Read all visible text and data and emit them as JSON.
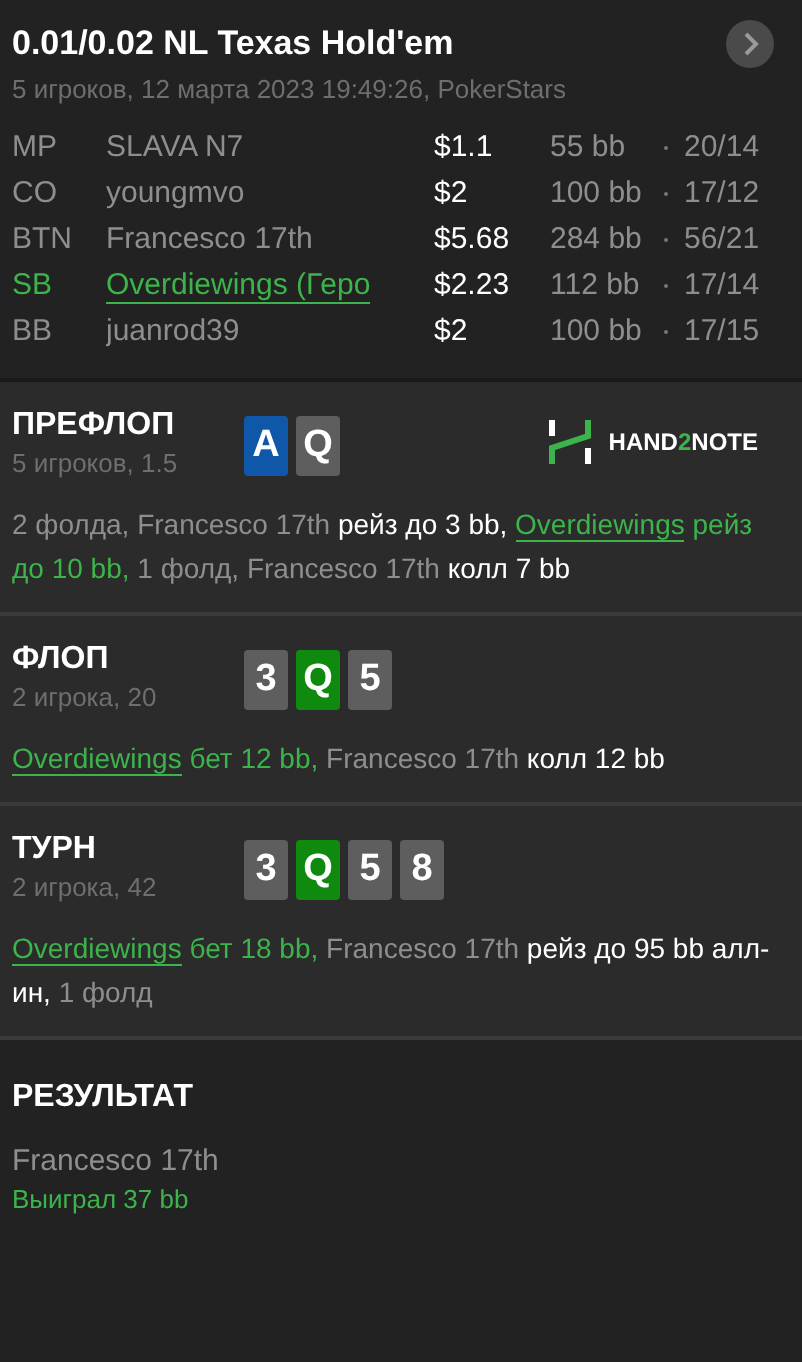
{
  "header": {
    "title": "0.01/0.02 NL Texas Hold'em",
    "subtitle": "5 игроков, 12 марта 2023 19:49:26, PokerStars"
  },
  "players": [
    {
      "position": "MP",
      "name": "SLAVA N7",
      "stack": "$1.1",
      "bb": "55 bb",
      "stats": "20/14",
      "hero": false
    },
    {
      "position": "CO",
      "name": "youngmvo",
      "stack": "$2",
      "bb": "100 bb",
      "stats": "17/12",
      "hero": false
    },
    {
      "position": "BTN",
      "name": "Francesco 17th",
      "stack": "$5.68",
      "bb": "284 bb",
      "stats": "56/21",
      "hero": false
    },
    {
      "position": "SB",
      "name": "Overdiewings (Геро",
      "stack": "$2.23",
      "bb": "112 bb",
      "stats": "17/14",
      "hero": true
    },
    {
      "position": "BB",
      "name": "juanrod39",
      "stack": "$2",
      "bb": "100 bb",
      "stats": "17/15",
      "hero": false
    }
  ],
  "streets": [
    {
      "title": "ПРЕФЛОП",
      "subtitle": "5 игроков, 1.5",
      "logo": [
        "HAND",
        "2",
        "NOTE"
      ],
      "cards": [
        {
          "rank": "A",
          "color": "#0f57a8"
        },
        {
          "rank": "Q",
          "color": "#5e5e5e"
        }
      ],
      "actions": [
        {
          "kind": "muted",
          "text": "2 фолда, Francesco 17th"
        },
        {
          "kind": "white",
          "text": "рейз до 3 bb,"
        },
        {
          "kind": "hero-name",
          "text": "Overdiewings"
        },
        {
          "kind": "hero",
          "text": "рейз до 10 bb,"
        },
        {
          "kind": "muted",
          "text": "1 фолд, Francesco 17th"
        },
        {
          "kind": "white",
          "text": "колл 7 bb"
        }
      ]
    },
    {
      "title": "ФЛОП",
      "subtitle": "2 игрока, 20",
      "cards": [
        {
          "rank": "3",
          "color": "#5e5e5e"
        },
        {
          "rank": "Q",
          "color": "#0f8a0f"
        },
        {
          "rank": "5",
          "color": "#5e5e5e"
        }
      ],
      "actions": [
        {
          "kind": "hero-name",
          "text": "Overdiewings"
        },
        {
          "kind": "hero",
          "text": "бет 12 bb,"
        },
        {
          "kind": "muted",
          "text": "Francesco 17th"
        },
        {
          "kind": "white",
          "text": "колл 12 bb"
        }
      ]
    },
    {
      "title": "ТУРН",
      "subtitle": "2 игрока, 42",
      "cards": [
        {
          "rank": "3",
          "color": "#5e5e5e"
        },
        {
          "rank": "Q",
          "color": "#0f8a0f"
        },
        {
          "rank": "5",
          "color": "#5e5e5e"
        },
        {
          "rank": "8",
          "color": "#5e5e5e"
        }
      ],
      "actions": [
        {
          "kind": "hero-name",
          "text": "Overdiewings"
        },
        {
          "kind": "hero",
          "text": "бет 18 bb,"
        },
        {
          "kind": "muted",
          "text": "Francesco 17th"
        },
        {
          "kind": "white",
          "text": "рейз до 95 bb алл-ин,"
        },
        {
          "kind": "muted",
          "text": "1 фолд"
        }
      ]
    }
  ],
  "result": {
    "title": "РЕЗУЛЬТАТ",
    "winner": "Francesco 17th",
    "amount": "Выиграл 37 bb"
  }
}
